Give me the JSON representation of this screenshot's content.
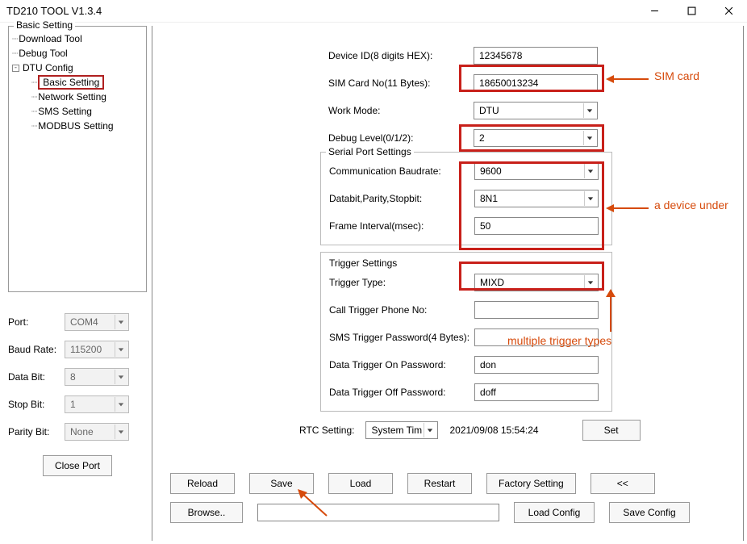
{
  "window": {
    "title": "TD210 TOOL V1.3.4"
  },
  "tree": {
    "title": "Basic Setting",
    "items": [
      {
        "label": "Download Tool",
        "indent": 1
      },
      {
        "label": "Debug Tool",
        "indent": 1
      },
      {
        "label": "DTU Config",
        "indent": 1,
        "expander": "-"
      },
      {
        "label": "Basic Setting",
        "indent": 2,
        "selected": true
      },
      {
        "label": "Network Setting",
        "indent": 2
      },
      {
        "label": "SMS Setting",
        "indent": 2
      },
      {
        "label": "MODBUS Setting",
        "indent": 2
      }
    ]
  },
  "port_panel": {
    "port_label": "Port:",
    "port_value": "COM4",
    "baud_label": "Baud Rate:",
    "baud_value": "115200",
    "databit_label": "Data Bit:",
    "databit_value": "8",
    "stopbit_label": "Stop Bit:",
    "stopbit_value": "1",
    "parity_label": "Parity Bit:",
    "parity_value": "None",
    "close_port": "Close Port"
  },
  "form": {
    "device_id_label": "Device ID(8 digits HEX):",
    "device_id_value": "12345678",
    "sim_label": "SIM Card No(11 Bytes):",
    "sim_value": "18650013234",
    "workmode_label": "Work Mode:",
    "workmode_value": "DTU",
    "debug_label": "Debug Level(0/1/2):",
    "debug_value": "2"
  },
  "serial": {
    "legend": "Serial Port Settings",
    "baud_label": "Communication Baudrate:",
    "baud_value": "9600",
    "dps_label": "Databit,Parity,Stopbit:",
    "dps_value": "8N1",
    "frame_label": "Frame Interval(msec):",
    "frame_value": "50"
  },
  "trigger": {
    "legend": "Trigger Settings",
    "type_label": "Trigger Type:",
    "type_value": "MIXD",
    "phone_label": "Call Trigger Phone No:",
    "phone_value": "",
    "smspw_label": "SMS Trigger Password(4 Bytes):",
    "smspw_value": "",
    "on_label": "Data Trigger On Password:",
    "on_value": "don",
    "off_label": "Data Trigger Off Password:",
    "off_value": "doff"
  },
  "rtc": {
    "label": "RTC Setting:",
    "value": "System Tim",
    "timestamp": "2021/09/08 15:54:24",
    "set": "Set"
  },
  "buttons": {
    "reload": "Reload",
    "save": "Save",
    "load": "Load",
    "restart": "Restart",
    "factory": "Factory Setting",
    "back": "<<",
    "browse": "Browse..",
    "load_config": "Load Config",
    "save_config": "Save Config"
  },
  "annot": {
    "sim": "SIM card",
    "device": "a device under",
    "trigger": "multiple trigger types"
  }
}
